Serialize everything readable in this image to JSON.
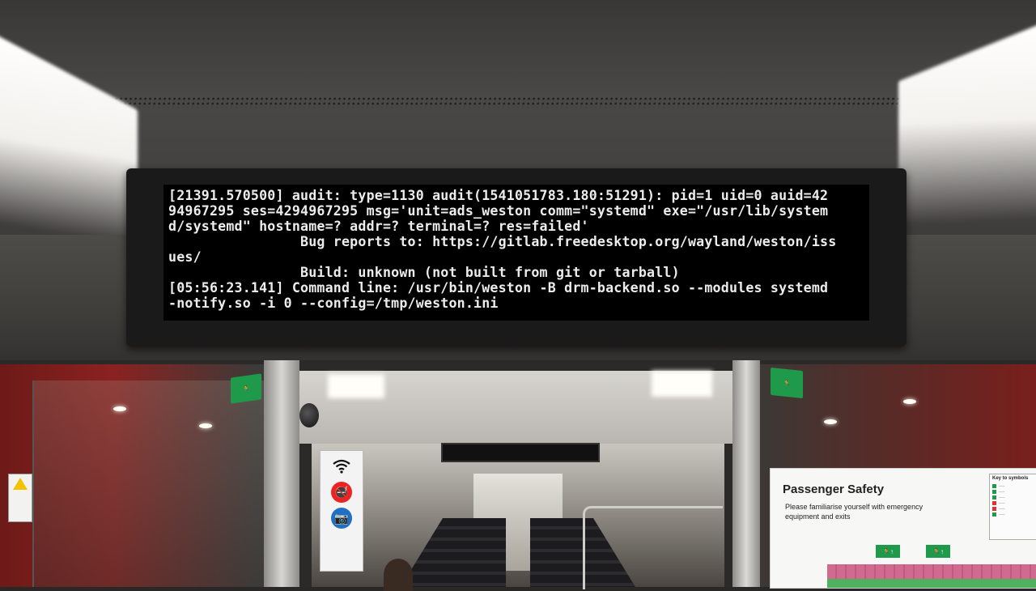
{
  "display": {
    "lines": [
      "[21391.570500] audit: type=1130 audit(1541051783.180:51291): pid=1 uid=0 auid=42",
      "94967295 ses=4294967295 msg='unit=ads_weston comm=\"systemd\" exe=\"/usr/lib/system",
      "d/systemd\" hostname=? addr=? terminal=? res=failed'",
      "                Bug reports to: https://gitlab.freedesktop.org/wayland/weston/iss",
      "ues/",
      "                Build: unknown (not built from git or tarball)",
      "[05:56:23.141] Command line: /usr/bin/weston -B drm-backend.so --modules systemd",
      "-notify.so -i 0 --config=/tmp/weston.ini"
    ]
  },
  "safety_board": {
    "title": "Passenger Safety",
    "subtitle": "Please familiarise yourself with emergency equipment and exits",
    "key_title": "Key to symbols"
  },
  "colors": {
    "terminal_text": "#ececec",
    "exit_green": "#1f9a4a",
    "wall_red": "#8a2220"
  },
  "icons": [
    "wifi-icon",
    "no-smoking-icon",
    "cctv-icon",
    "exit-sign-icon",
    "warning-icon"
  ]
}
